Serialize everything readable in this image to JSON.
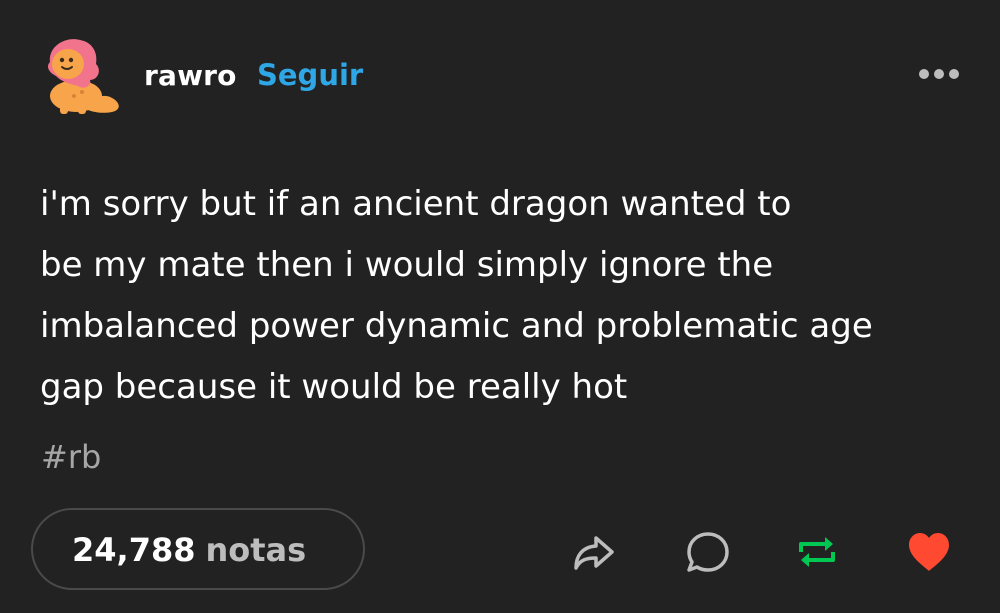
{
  "post": {
    "author": "rawro",
    "follow_label": "Seguir",
    "text": "i'm sorry but if an ancient dragon wanted to\nbe my mate then i would simply ignore the\nimbalanced power dynamic and problematic age\ngap because it would be really hot",
    "tag": "#rb",
    "notes_count": "24,788",
    "notes_label": "notas"
  },
  "icons": {
    "avatar": "dragon-avatar",
    "more": "more-horizontal-icon",
    "share": "share-icon",
    "reply": "reply-icon",
    "reblog": "reblog-icon",
    "like": "heart-icon"
  },
  "colors": {
    "background": "#222222",
    "follow": "#2fa7e6",
    "reblog_active": "#00c853",
    "like_active": "#ff4930",
    "muted": "#a6a6a6"
  }
}
